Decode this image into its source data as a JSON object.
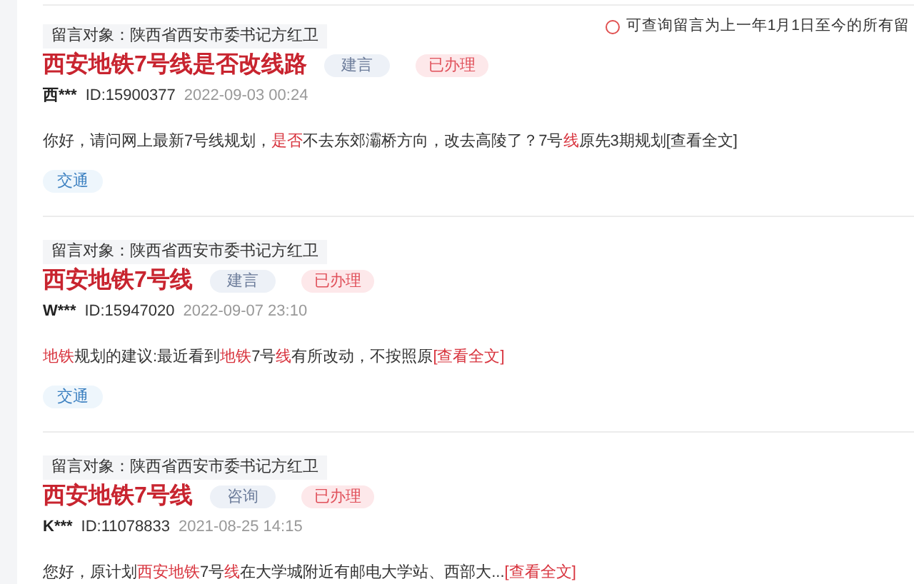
{
  "notice": {
    "text": "可查询留言为上一年1月1日至今的所有留"
  },
  "messages": [
    {
      "target": "留言对象：陕西省西安市委书记方红卫",
      "title": "西安地铁7号线是否改线路",
      "type": "建言",
      "status": "已办理",
      "author": "西***",
      "id": "ID:15900377",
      "date": "2022-09-03 00:24",
      "snippet": [
        {
          "text": "你好，请问网上最新7号线规划，",
          "highlight": false
        },
        {
          "text": "是否",
          "highlight": true
        },
        {
          "text": "不去东郊灞桥方向，改去高陵了？7号",
          "highlight": false
        },
        {
          "text": "线",
          "highlight": true
        },
        {
          "text": "原先3期规划",
          "highlight": false
        }
      ],
      "more": {
        "text": "[查看全文]",
        "highlight": false
      },
      "tags": [
        "交通"
      ]
    },
    {
      "target": "留言对象：陕西省西安市委书记方红卫",
      "title": "西安地铁7号线",
      "type": "建言",
      "status": "已办理",
      "author": "W***",
      "id": "ID:15947020",
      "date": "2022-09-07 23:10",
      "snippet": [
        {
          "text": "地铁",
          "highlight": true
        },
        {
          "text": "规划的建议:最近看到",
          "highlight": false
        },
        {
          "text": "地铁",
          "highlight": true
        },
        {
          "text": "7号",
          "highlight": false
        },
        {
          "text": "线",
          "highlight": true
        },
        {
          "text": "有所改动，不按照原",
          "highlight": false
        }
      ],
      "more": {
        "text": "[查看全文]",
        "highlight": true
      },
      "tags": [
        "交通"
      ]
    },
    {
      "target": "留言对象：陕西省西安市委书记方红卫",
      "title": "西安地铁7号线",
      "type": "咨询",
      "status": "已办理",
      "author": "K***",
      "id": "ID:11078833",
      "date": "2021-08-25 14:15",
      "snippet": [
        {
          "text": "您好，原计划",
          "highlight": false
        },
        {
          "text": "西安地铁",
          "highlight": true
        },
        {
          "text": "7号",
          "highlight": false
        },
        {
          "text": "线",
          "highlight": true
        },
        {
          "text": "在大学城附近有邮电大学站、西部大...",
          "highlight": false
        }
      ],
      "more": {
        "text": "[查看全文]",
        "highlight": true
      }
    }
  ]
}
